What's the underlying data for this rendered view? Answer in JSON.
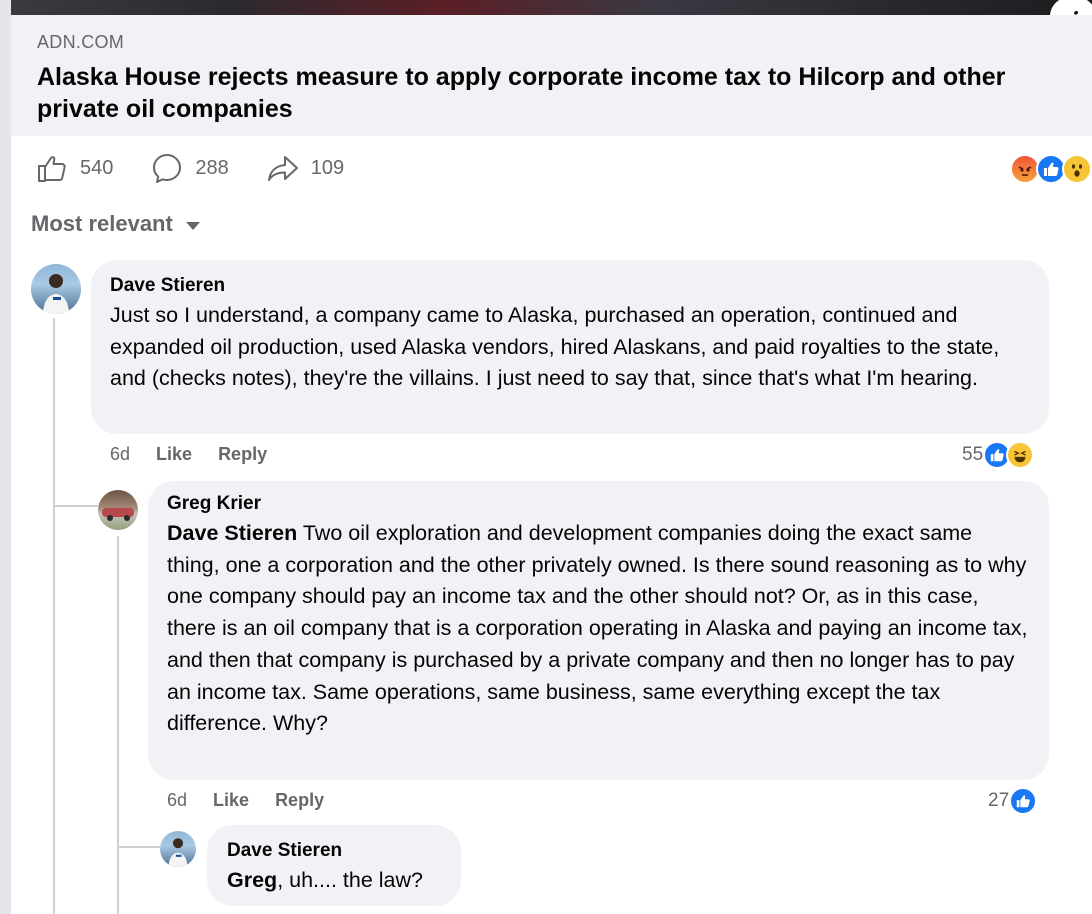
{
  "link_preview": {
    "domain": "ADN.COM",
    "title": "Alaska House rejects measure to apply corporate income tax to Hilcorp and other private oil companies",
    "info_icon": "info-icon"
  },
  "actions": {
    "likes": "540",
    "comments": "288",
    "shares": "109"
  },
  "post_reactions": [
    "angry",
    "like",
    "wow"
  ],
  "sort": {
    "label": "Most relevant"
  },
  "comments": [
    {
      "author": "Dave Stieren",
      "text": "Just so I understand, a company came to Alaska, purchased an operation, continued and expanded oil production, used Alaska vendors, hired Alaskans, and paid royalties to the state, and (checks notes), they're the villains. I just need to say that, since that's what I'm hearing.",
      "time": "6d",
      "like_label": "Like",
      "reply_label": "Reply",
      "reaction_count": "55",
      "reactions": [
        "like",
        "haha"
      ]
    },
    {
      "author": "Greg Krier",
      "mention": "Dave Stieren",
      "text": " Two oil exploration and development companies doing the exact same thing, one a corporation and the other privately owned. Is there sound reasoning as to why one company should pay an income tax and the other should not? Or, as in this case, there is an oil company that is a corporation operating in Alaska and paying an income tax, and then that company is purchased by a private company and then no longer has to pay an income tax. Same operations, same business, same everything except the tax difference. Why?",
      "time": "6d",
      "like_label": "Like",
      "reply_label": "Reply",
      "reaction_count": "27",
      "reactions": [
        "like"
      ]
    },
    {
      "author": "Dave Stieren",
      "mention": "Greg",
      "text": ", uh.... the law?"
    }
  ],
  "colors": {
    "bubble_bg": "#f0f2f5",
    "secondary_text": "#65676b",
    "like_blue": "#1877f2"
  }
}
